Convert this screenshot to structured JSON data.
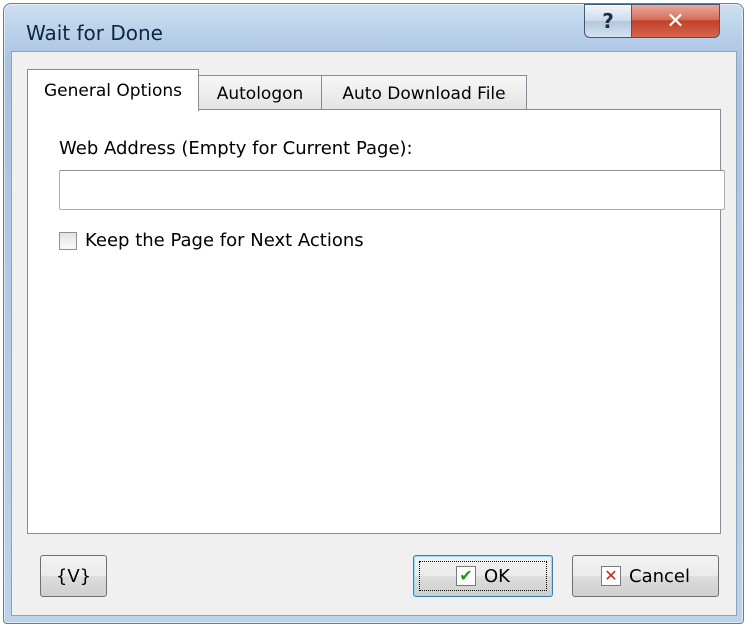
{
  "window": {
    "title": "Wait for Done",
    "help_glyph": "?",
    "close_glyph": "✕"
  },
  "tabs": [
    {
      "label": "General Options",
      "active": true
    },
    {
      "label": "Autologon",
      "active": false
    },
    {
      "label": "Auto Download File",
      "active": false
    }
  ],
  "general": {
    "web_address_label": "Web Address (Empty for Current Page):",
    "web_address_value": "",
    "keep_page_label": "Keep the Page for Next Actions",
    "keep_page_checked": false
  },
  "buttons": {
    "variables_label": "{V}",
    "ok_label": "OK",
    "ok_glyph": "✔",
    "cancel_label": "Cancel",
    "cancel_glyph": "✕"
  },
  "icons": {
    "help": "help-icon",
    "close": "close-icon",
    "ok": "check-icon",
    "cancel": "cross-icon"
  },
  "colors": {
    "ok_check": "#1c9a1c",
    "cancel_cross": "#d0201c",
    "close_button": "#c2402a"
  }
}
